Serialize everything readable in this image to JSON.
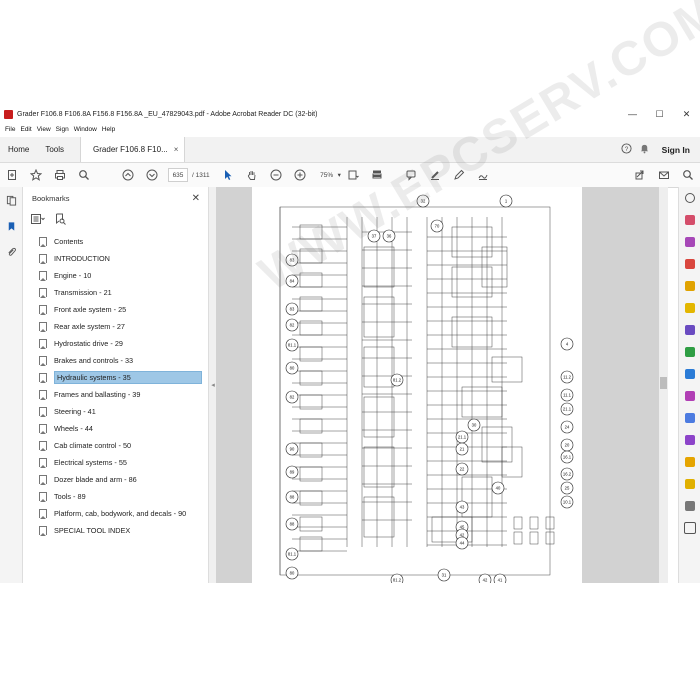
{
  "window": {
    "title": "Grader F106.8 F106.8A F156.8 F156.8A _EU_47829043.pdf - Adobe Acrobat Reader DC (32-bit)",
    "minimize": "—",
    "maximize": "☐",
    "close": "✕"
  },
  "menu": [
    "File",
    "Edit",
    "View",
    "Sign",
    "Window",
    "Help"
  ],
  "tabs": {
    "home": "Home",
    "tools": "Tools",
    "document": "Grader F106.8 F10...",
    "document_close": "×",
    "sign_in": "Sign In"
  },
  "toolbar": {
    "page_current": "635",
    "page_separator": "/",
    "page_total": "1311",
    "zoom": "75%",
    "icons": [
      "new-file-icon",
      "bookmark-star-icon",
      "print-icon",
      "search-icon",
      "prev-page-icon",
      "next-page-icon",
      "select-cursor-icon",
      "hand-icon",
      "zoom-out-icon",
      "zoom-in-icon",
      "page-fit-icon",
      "comment-icon",
      "highlight-icon",
      "signature-icon",
      "fill-sign-icon",
      "share-link-icon",
      "email-icon",
      "search-icon-right"
    ]
  },
  "bookmarks": {
    "title": "Bookmarks",
    "close": "✕",
    "items": [
      {
        "label": "Contents"
      },
      {
        "label": "INTRODUCTION"
      },
      {
        "label": "Engine - 10"
      },
      {
        "label": "Transmission - 21"
      },
      {
        "label": "Front axle system - 25"
      },
      {
        "label": "Rear axle system - 27"
      },
      {
        "label": "Hydrostatic drive - 29"
      },
      {
        "label": "Brakes and controls - 33"
      },
      {
        "label": "Hydraulic systems - 35"
      },
      {
        "label": "Frames and ballasting - 39"
      },
      {
        "label": "Steering - 41"
      },
      {
        "label": "Wheels - 44"
      },
      {
        "label": "Cab climate control - 50"
      },
      {
        "label": "Electrical systems - 55"
      },
      {
        "label": "Dozer blade and arm - 86"
      },
      {
        "label": "Tools - 89"
      },
      {
        "label": "Platform, cab, bodywork, and decals - 90"
      },
      {
        "label": "SPECIAL TOOL INDEX"
      }
    ],
    "selected_index": 8
  },
  "diagram": {
    "callouts": [
      "32",
      "1",
      "70",
      "37",
      "36",
      "83",
      "84",
      "83",
      "82",
      "81.1",
      "4",
      "80",
      "81.2",
      "11.2",
      "11.1",
      "82",
      "21.1",
      "30",
      "24",
      "20",
      "21.1",
      "21",
      "90",
      "16.1",
      "22",
      "89",
      "16.2",
      "25",
      "88",
      "40",
      "10.1",
      "43",
      "45",
      "88",
      "42",
      "81.1",
      "44",
      "80",
      "42",
      "41",
      "81.2",
      "31"
    ]
  },
  "watermark": "WWW.EPCSERV.COM",
  "colors": {
    "selection": "#9ec7e6",
    "accent_red": "#c81d1d",
    "doc_background": "#d2d2d2"
  }
}
